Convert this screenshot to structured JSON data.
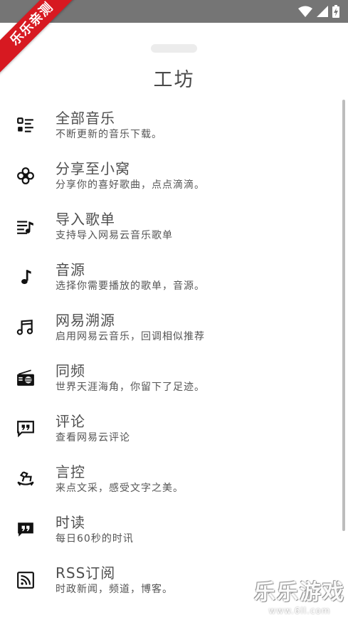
{
  "watermark": {
    "ribbon": "乐乐亲测",
    "corner_main": "乐乐游戏",
    "corner_url": "www.6ll.com"
  },
  "sheet": {
    "title": "工坊"
  },
  "menu": [
    {
      "title": "全部音乐",
      "subtitle": "不断更新的音乐下载。",
      "icon": "list-grid-icon"
    },
    {
      "title": "分享至小窝",
      "subtitle": "分享你的喜好歌曲，点点滴滴。",
      "icon": "flower-icon"
    },
    {
      "title": "导入歌单",
      "subtitle": "支持导入网易云音乐歌单",
      "icon": "playlist-import-icon"
    },
    {
      "title": "音源",
      "subtitle": "选择你需要播放的歌单，音源。",
      "icon": "music-note-icon"
    },
    {
      "title": "网易溯源",
      "subtitle": "启用网易云音乐，回调相似推荐",
      "icon": "double-note-icon"
    },
    {
      "title": "同频",
      "subtitle": "世界天涯海角，你留下了足迹。",
      "icon": "radio-icon"
    },
    {
      "title": "评论",
      "subtitle": "查看网易云评论",
      "icon": "comment-icon"
    },
    {
      "title": "言控",
      "subtitle": "来点文采，感受文字之美。",
      "icon": "rocking-horse-icon"
    },
    {
      "title": "时读",
      "subtitle": "每日60秒的时讯",
      "icon": "quote-icon"
    },
    {
      "title": "RSS订阅",
      "subtitle": "时政新闻，频道，博客。",
      "icon": "rss-icon"
    }
  ]
}
